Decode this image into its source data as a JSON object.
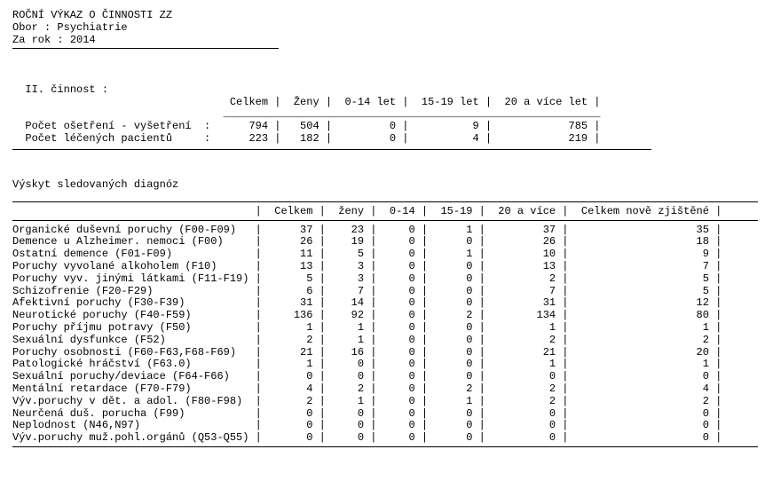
{
  "header": {
    "title": "ROČNÍ VÝKAZ O ČINNOSTI ZZ",
    "obor_label": "Obor   :",
    "obor_value": "Psychiatrie",
    "rok_label": "Za rok :",
    "rok_value": "2014"
  },
  "section2": {
    "title": "II. činnost :",
    "cols": [
      "Celkem",
      "Ženy",
      "0-14 let",
      "15-19 let",
      "20 a více let"
    ],
    "rows": [
      {
        "label": "Počet ošetření - vyšetření",
        "vals": [
          "794",
          "504",
          "0",
          "9",
          "785"
        ]
      },
      {
        "label": "Počet léčených pacientů",
        "vals": [
          "223",
          "182",
          "0",
          "4",
          "219"
        ]
      }
    ]
  },
  "diag": {
    "title": "Výskyt sledovaných diagnóz",
    "cols": [
      "Celkem",
      "ženy",
      "0-14",
      "15-19",
      "20 a více",
      "Celkem nově zjištěné"
    ],
    "rows": [
      {
        "label": "Organické duševní poruchy (F00-F09)",
        "vals": [
          "37",
          "23",
          "0",
          "1",
          "37",
          "35"
        ]
      },
      {
        "label": "Demence u Alzheimer. nemoci (F00)",
        "vals": [
          "26",
          "19",
          "0",
          "0",
          "26",
          "18"
        ]
      },
      {
        "label": "Ostatní demence (F01-F09)",
        "vals": [
          "11",
          "5",
          "0",
          "1",
          "10",
          "9"
        ]
      },
      {
        "label": "Poruchy vyvolané alkoholem (F10)",
        "vals": [
          "13",
          "3",
          "0",
          "0",
          "13",
          "7"
        ]
      },
      {
        "label": "Poruchy vyv. jinými látkami (F11-F19)",
        "vals": [
          "5",
          "3",
          "0",
          "0",
          "2",
          "5"
        ]
      },
      {
        "label": "Schizofrenie (F20-F29)",
        "vals": [
          "6",
          "7",
          "0",
          "0",
          "7",
          "5"
        ]
      },
      {
        "label": "Afektivní poruchy (F30-F39)",
        "vals": [
          "31",
          "14",
          "0",
          "0",
          "31",
          "12"
        ]
      },
      {
        "label": "Neurotické poruchy (F40-F59)",
        "vals": [
          "136",
          "92",
          "0",
          "2",
          "134",
          "80"
        ]
      },
      {
        "label": "Poruchy příjmu potravy (F50)",
        "vals": [
          "1",
          "1",
          "0",
          "0",
          "1",
          "1"
        ]
      },
      {
        "label": "Sexuální dysfunkce (F52)",
        "vals": [
          "2",
          "1",
          "0",
          "0",
          "2",
          "2"
        ]
      },
      {
        "label": "Poruchy osobnosti (F60-F63,F68-F69)",
        "vals": [
          "21",
          "16",
          "0",
          "0",
          "21",
          "20"
        ]
      },
      {
        "label": "Patologické hráčství (F63.0)",
        "vals": [
          "1",
          "0",
          "0",
          "0",
          "1",
          "1"
        ]
      },
      {
        "label": "Sexuální poruchy/deviace (F64-F66)",
        "vals": [
          "0",
          "0",
          "0",
          "0",
          "0",
          "0"
        ]
      },
      {
        "label": "Mentální retardace (F70-F79)",
        "vals": [
          "4",
          "2",
          "0",
          "2",
          "2",
          "4"
        ]
      },
      {
        "label": "Výv.poruchy v dět. a adol. (F80-F98)",
        "vals": [
          "2",
          "1",
          "0",
          "1",
          "2",
          "2"
        ]
      },
      {
        "label": "Neurčená duš. porucha (F99)",
        "vals": [
          "0",
          "0",
          "0",
          "0",
          "0",
          "0"
        ]
      },
      {
        "label": "Neplodnost (N46,N97)",
        "vals": [
          "0",
          "0",
          "0",
          "0",
          "0",
          "0"
        ]
      },
      {
        "label": "Výv.poruchy muž.pohl.orgánů (Q53-Q55)",
        "vals": [
          "0",
          "0",
          "0",
          "0",
          "0",
          "0"
        ]
      }
    ]
  }
}
